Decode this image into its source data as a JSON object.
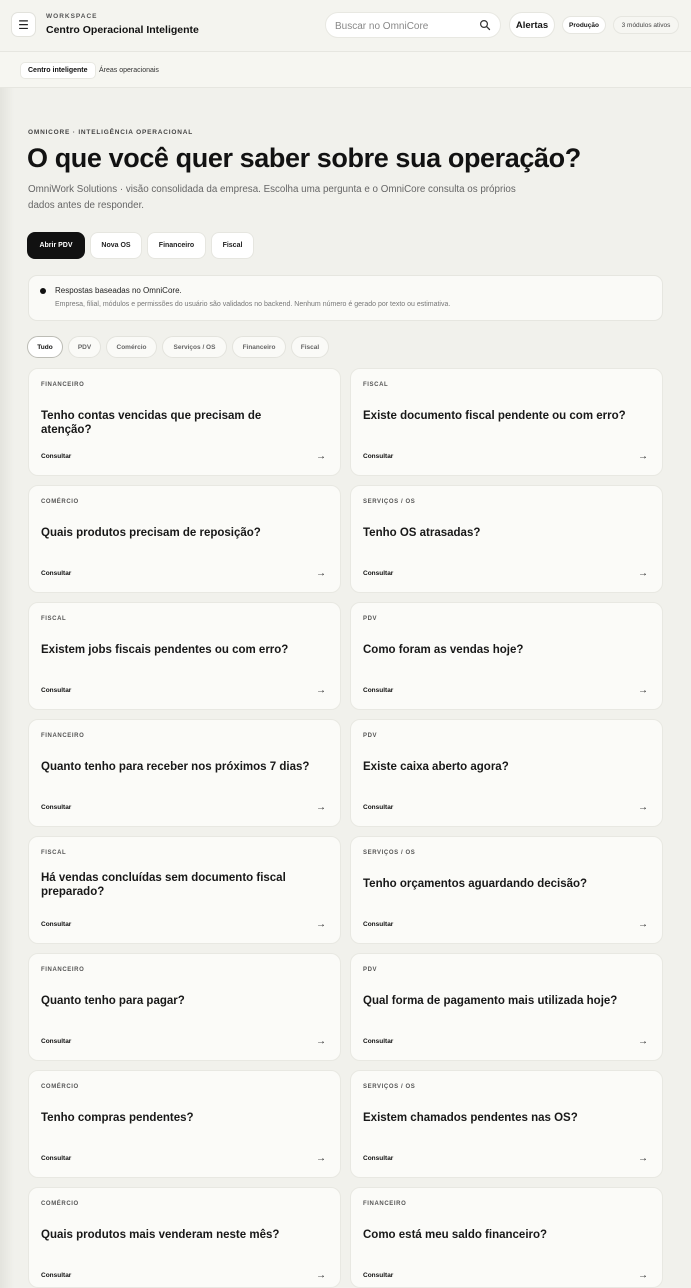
{
  "header": {
    "menu_icon": "hamburger-icon",
    "workspace_label": "WORKSPACE",
    "workspace_title": "Centro Operacional Inteligente",
    "search_placeholder": "Buscar no OmniCore",
    "alerts_label": "Alertas",
    "environment_label": "Produção",
    "modules_label": "3 módulos ativos"
  },
  "subnav": {
    "items": [
      "Centro inteligente",
      "Áreas operacionais"
    ]
  },
  "hero": {
    "eyebrow": "OMNICORE · INTELIGÊNCIA OPERACIONAL",
    "title": "O que você quer saber sobre sua operação?",
    "description": "OmniWork Solutions · visão consolidada da empresa. Escolha uma pergunta e o OmniCore consulta os próprios dados antes de responder.",
    "actions": [
      "Abrir PDV",
      "Nova OS",
      "Financeiro",
      "Fiscal"
    ]
  },
  "info": {
    "title": "Respostas baseadas no OmniCore.",
    "text": "Empresa, filial, módulos e permissões do usuário são validados no backend. Nenhum número é gerado por texto ou estimativa."
  },
  "filters": [
    "Tudo",
    "PDV",
    "Comércio",
    "Serviços / OS",
    "Financeiro",
    "Fiscal"
  ],
  "cards": {
    "cta": "Consultar",
    "arrow": "→",
    "items": [
      {
        "category": "FINANCEIRO",
        "question": "Tenho contas vencidas que precisam de atenção?"
      },
      {
        "category": "FISCAL",
        "question": "Existe documento fiscal pendente ou com erro?"
      },
      {
        "category": "COMÉRCIO",
        "question": "Quais produtos precisam de reposição?"
      },
      {
        "category": "SERVIÇOS / OS",
        "question": "Tenho OS atrasadas?"
      },
      {
        "category": "FISCAL",
        "question": "Existem jobs fiscais pendentes ou com erro?"
      },
      {
        "category": "PDV",
        "question": "Como foram as vendas hoje?"
      },
      {
        "category": "FINANCEIRO",
        "question": "Quanto tenho para receber nos próximos 7 dias?"
      },
      {
        "category": "PDV",
        "question": "Existe caixa aberto agora?"
      },
      {
        "category": "FISCAL",
        "question": "Há vendas concluídas sem documento fiscal preparado?"
      },
      {
        "category": "SERVIÇOS / OS",
        "question": "Tenho orçamentos aguardando decisão?"
      },
      {
        "category": "FINANCEIRO",
        "question": "Quanto tenho para pagar?"
      },
      {
        "category": "PDV",
        "question": "Qual forma de pagamento mais utilizada hoje?"
      },
      {
        "category": "COMÉRCIO",
        "question": "Tenho compras pendentes?"
      },
      {
        "category": "SERVIÇOS / OS",
        "question": "Existem chamados pendentes nas OS?"
      },
      {
        "category": "COMÉRCIO",
        "question": "Quais produtos mais venderam neste mês?"
      },
      {
        "category": "FINANCEIRO",
        "question": "Como está meu saldo financeiro?"
      }
    ]
  }
}
